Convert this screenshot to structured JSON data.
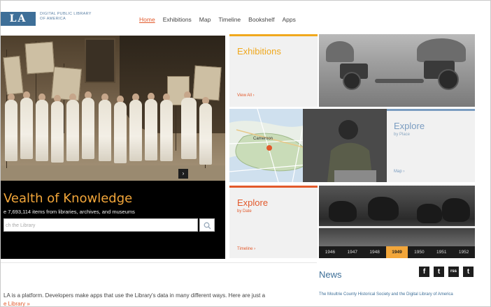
{
  "logo": {
    "mark": "LA",
    "tagline_1": "DIGITAL PUBLIC LIBRARY",
    "tagline_2": "OF AMERICA"
  },
  "nav": [
    "Home",
    "Exhibitions",
    "Map",
    "Timeline",
    "Bookshelf",
    "Apps"
  ],
  "hero": {
    "title": "Vealth of Knowledge",
    "subtitle": "e 7,693,114 items from libraries, archives, and museums",
    "search_placeholder": "ch the Library",
    "arrow": "›"
  },
  "tiles": {
    "exhibitions": {
      "label": "Exhibitions",
      "link": "View All ›"
    },
    "place": {
      "label": "Explore",
      "sub": "by Place",
      "link": "Map ›"
    },
    "date": {
      "label": "Explore",
      "sub": "by Date",
      "link": "Timeline ›"
    },
    "map_city": "Cameroon"
  },
  "years": [
    "1946",
    "1947",
    "1948",
    "1949",
    "1950",
    "1951",
    "1952"
  ],
  "selected_year": "1949",
  "news": {
    "title": "News",
    "item": "The Moultrie County Historical Society and the Digital Library of America"
  },
  "social": [
    "f",
    "t",
    "rss",
    "t"
  ],
  "body": {
    "text": "LA is a platform. Developers make apps that use the Library's data in many different ways. Here are just a",
    "link": "e Library »"
  },
  "colors": {
    "accent": "#e2592b",
    "gold": "#f2a63a",
    "blue": "#3e6f98"
  }
}
